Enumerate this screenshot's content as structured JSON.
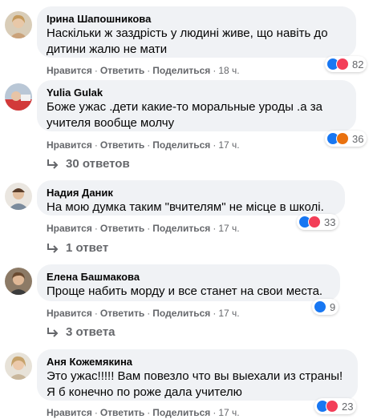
{
  "actions": {
    "like": "Нравится",
    "reply": "Ответить",
    "share": "Поделиться",
    "sep": "·"
  },
  "comments": [
    {
      "author": "Ірина Шапошникова",
      "text": "Наскільки ж заздрість у людині живе, що навіть до\nдитини жалю не мати",
      "time": "18 ч.",
      "reactions": "82",
      "reaction_icons": [
        "like-icon",
        "love-icon"
      ],
      "replies": ""
    },
    {
      "author": "Yulia Gulak",
      "text": "Боже ужас .дети какие-то моральные уроды .а за\nучителя вообще молчу",
      "time": "17 ч.",
      "reactions": "36",
      "reaction_icons": [
        "like-icon",
        "angry-icon"
      ],
      "replies": "30 ответов"
    },
    {
      "author": "Надия Даник",
      "text": "На мою думка таким \"вчителям\" не місце в школі.",
      "time": "17 ч.",
      "reactions": "33",
      "reaction_icons": [
        "like-icon",
        "love-icon"
      ],
      "replies": "1 ответ"
    },
    {
      "author": "Елена Башмакова",
      "text": "Проще набить морду и все станет на свои места.",
      "time": "17 ч.",
      "reactions": "9",
      "reaction_icons": [
        "like-icon"
      ],
      "replies": "3 ответа"
    },
    {
      "author": "Аня Кожемякина",
      "text": "Это ужас!!!!! Вам повезло что вы выехали из страны!\nЯ б конечно по роже дала учителю",
      "time": "17 ч.",
      "reactions": "23",
      "reaction_icons": [
        "like-icon",
        "love-icon"
      ],
      "replies": ""
    }
  ]
}
